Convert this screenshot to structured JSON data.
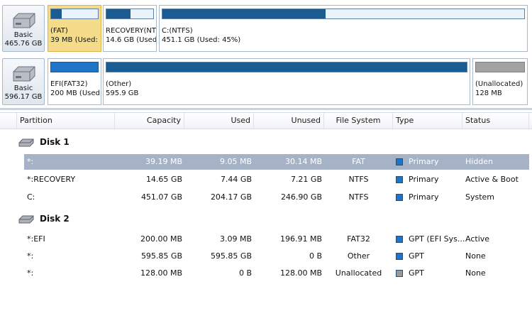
{
  "colors": {
    "primary_square": "#1f74c8",
    "unallocated_square": "#9a9a9a",
    "selected_row": "#a6b3c6",
    "selected_partition": "#f5dc8a",
    "usage_fill": "#1a5c91"
  },
  "disks": [
    {
      "type_label": "Basic",
      "size_label": "465.76 GB",
      "icon": "hard-disk-icon",
      "partitions": [
        {
          "label": "(FAT)",
          "info": "39 MB (Used: :",
          "used_fraction": 0.23,
          "style": "usage",
          "selected": true
        },
        {
          "label": "RECOVERY(NT",
          "info": "14.6 GB (Used",
          "used_fraction": 0.51,
          "style": "usage",
          "selected": false
        },
        {
          "label": "C:(NTFS)",
          "info": "451.1 GB (Used: 45%)",
          "used_fraction": 0.45,
          "style": "usage",
          "selected": false
        }
      ]
    },
    {
      "type_label": "Basic",
      "size_label": "596.17 GB",
      "icon": "hard-disk-icon",
      "partitions": [
        {
          "label": "EFI(FAT32)",
          "info": "200 MB (Used:",
          "used_fraction": 0.02,
          "style": "solid",
          "selected": false
        },
        {
          "label": "(Other)",
          "info": "595.9 GB",
          "used_fraction": 1.0,
          "style": "usage",
          "selected": false
        },
        {
          "label": "(Unallocated)",
          "info": "128 MB",
          "used_fraction": 1.0,
          "style": "gray",
          "selected": false
        }
      ]
    }
  ],
  "columns": [
    "Partition",
    "Capacity",
    "Used",
    "Unused",
    "File System",
    "Type",
    "Status"
  ],
  "groups": [
    {
      "name": "Disk 1",
      "icon": "disk-icon",
      "rows": [
        {
          "partition": "*:",
          "capacity": "39.19 MB",
          "used": "9.05 MB",
          "unused": "30.14 MB",
          "fs": "FAT",
          "type": "Primary",
          "type_color": "#1f74c8",
          "status": "Hidden",
          "selected": true
        },
        {
          "partition": "*:RECOVERY",
          "capacity": "14.65 GB",
          "used": "7.44 GB",
          "unused": "7.21 GB",
          "fs": "NTFS",
          "type": "Primary",
          "type_color": "#1f74c8",
          "status": "Active & Boot",
          "selected": false
        },
        {
          "partition": "C:",
          "capacity": "451.07 GB",
          "used": "204.17 GB",
          "unused": "246.90 GB",
          "fs": "NTFS",
          "type": "Primary",
          "type_color": "#1f74c8",
          "status": "System",
          "selected": false
        }
      ]
    },
    {
      "name": "Disk 2",
      "icon": "disk-icon",
      "rows": [
        {
          "partition": "*:EFI",
          "capacity": "200.00 MB",
          "used": "3.09 MB",
          "unused": "196.91 MB",
          "fs": "FAT32",
          "type": "GPT (EFI Sys...",
          "type_color": "#1f74c8",
          "status": "Active",
          "selected": false
        },
        {
          "partition": "*:",
          "capacity": "595.85 GB",
          "used": "595.85 GB",
          "unused": "0 B",
          "fs": "Other",
          "type": "GPT",
          "type_color": "#1f74c8",
          "status": "None",
          "selected": false
        },
        {
          "partition": "*:",
          "capacity": "128.00 MB",
          "used": "0 B",
          "unused": "128.00 MB",
          "fs": "Unallocated",
          "type": "GPT",
          "type_color": "#9a9a9a",
          "status": "None",
          "selected": false
        }
      ]
    }
  ]
}
